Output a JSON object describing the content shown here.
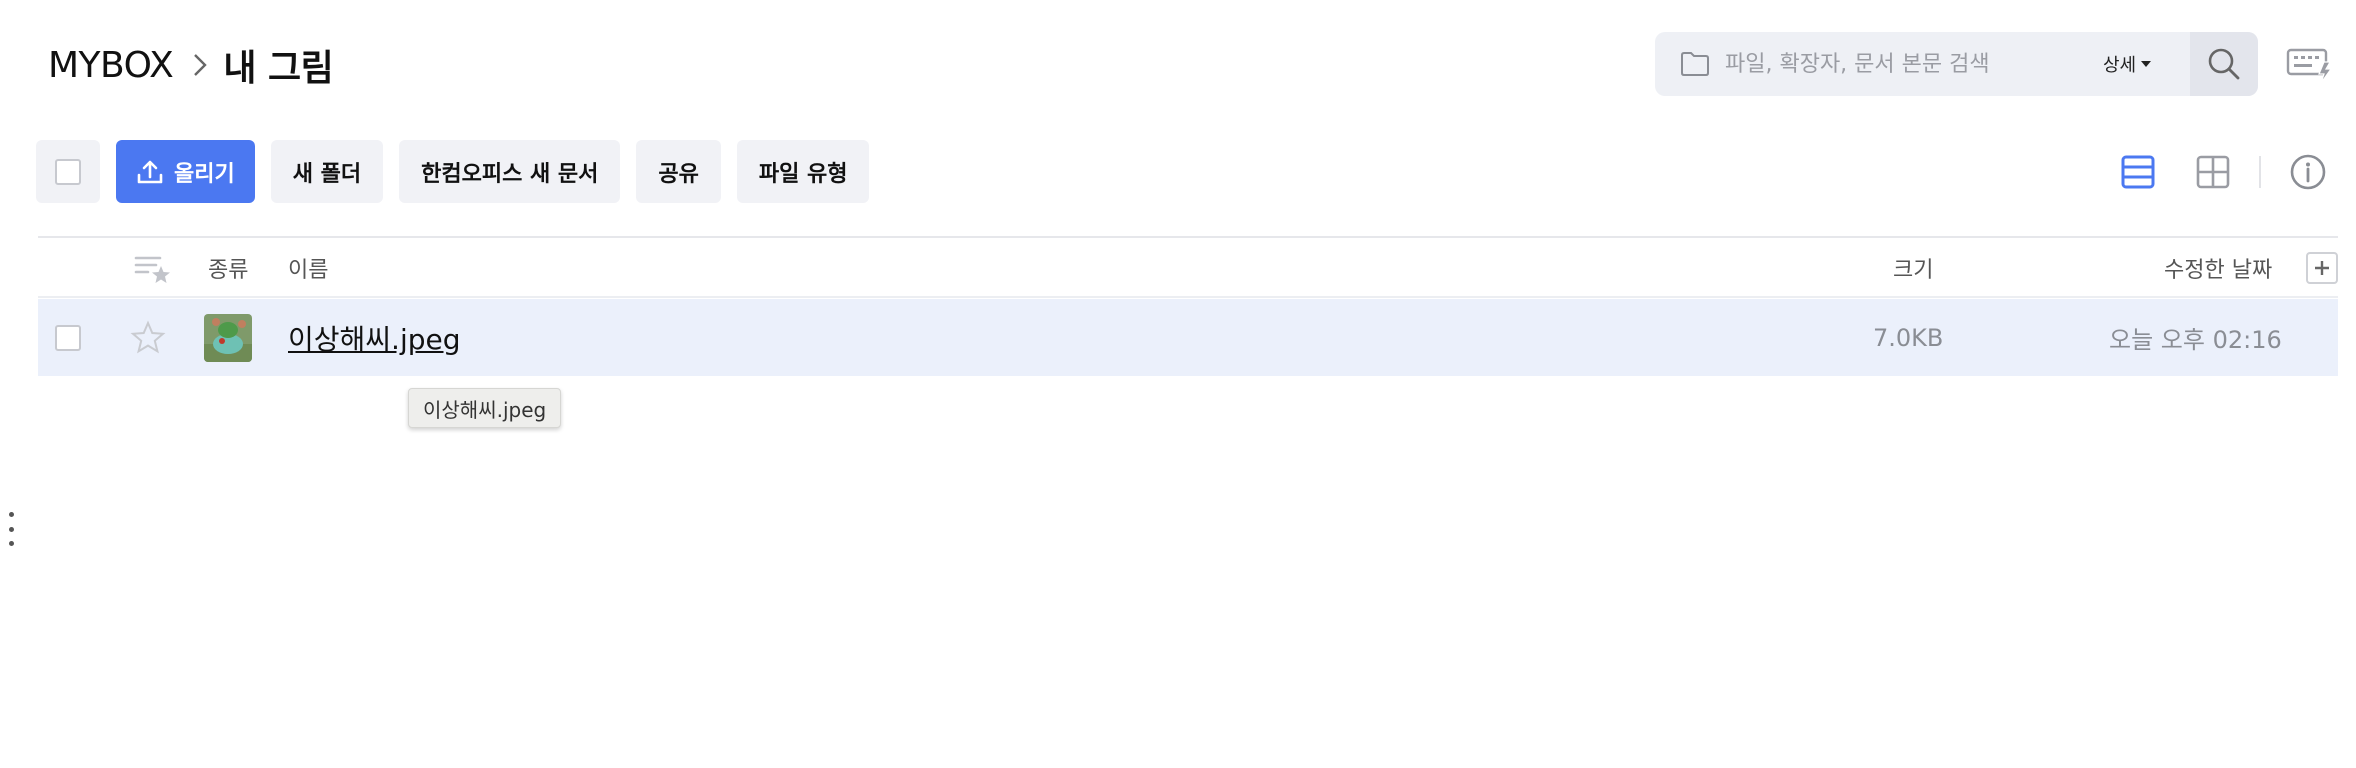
{
  "breadcrumb": {
    "root": "MYBOX",
    "current": "내 그림"
  },
  "search": {
    "placeholder": "파일, 확장자, 문서 본문 검색",
    "detail_label": "상세"
  },
  "toolbar": {
    "upload_label": "올리기",
    "new_folder_label": "새 폴더",
    "hancom_new_doc_label": "한컴오피스 새 문서",
    "share_label": "공유",
    "file_type_label": "파일 유형"
  },
  "table": {
    "columns": {
      "type": "종류",
      "name": "이름",
      "size": "크기",
      "modified": "수정한 날짜"
    },
    "rows": [
      {
        "name": "이상해씨.jpeg",
        "size": "7.0KB",
        "modified": "오늘 오후 02:16",
        "starred": false
      }
    ]
  },
  "tooltip": {
    "text": "이상해씨.jpeg"
  },
  "colors": {
    "accent": "#4b78f1",
    "row_selected": "#ebf0fb",
    "button_bg": "#f1f2f6"
  }
}
